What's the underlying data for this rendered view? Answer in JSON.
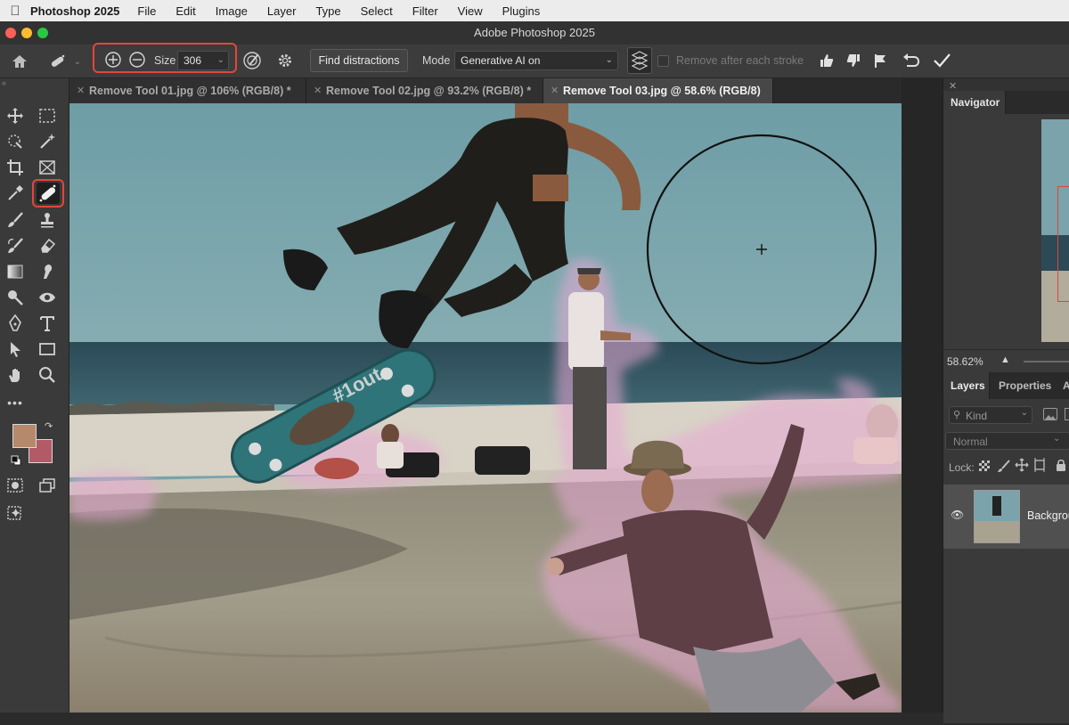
{
  "menubar": {
    "app_name": "Photoshop 2025",
    "items": [
      "File",
      "Edit",
      "Image",
      "Layer",
      "Type",
      "Select",
      "Filter",
      "View",
      "Plugins"
    ]
  },
  "window": {
    "title": "Adobe Photoshop 2025"
  },
  "options_bar": {
    "size_label": "Size",
    "size_value": "306",
    "find_distractions_label": "Find distractions",
    "mode_label": "Mode",
    "mode_value": "Generative AI on",
    "remove_after_stroke_label": "Remove after each stroke"
  },
  "tabs": [
    {
      "label": "Remove Tool 01.jpg @ 106% (RGB/8) *",
      "active": false
    },
    {
      "label": "Remove Tool 02.jpg @ 93.2% (RGB/8) *",
      "active": false
    },
    {
      "label": "Remove Tool 03.jpg @ 58.6% (RGB/8)",
      "active": true
    }
  ],
  "canvas": {
    "board_text": "#1out"
  },
  "navigator": {
    "title": "Navigator",
    "zoom": "58.62%"
  },
  "layers_panel": {
    "tabs": [
      "Layers",
      "Properties",
      "A"
    ],
    "kind_placeholder": "Kind",
    "blend_mode": "Normal",
    "lock_label": "Lock:",
    "layer_name": "Backgrou"
  },
  "colors": {
    "foreground": "#b58a6c",
    "background": "#b25a66",
    "highlight": "#e2463d",
    "brush_mask": "#e8a9d4"
  }
}
